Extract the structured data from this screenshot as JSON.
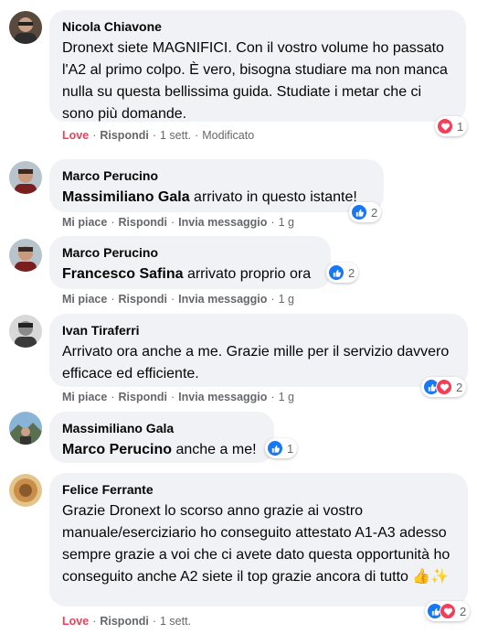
{
  "comments": [
    {
      "author": "Nicola Chiavone",
      "mention": "",
      "text": "Dronext siete MAGNIFICI. Con il vostro volume ho passato l'A2 al primo colpo. È vero, bisogna studiare ma non manca nulla su questa bellissima guida. Studiate i metar che ci sono più domande.",
      "reaction_action": "Love",
      "reply": "Rispondi",
      "time": "1 sett.",
      "edited": "Modificato",
      "reactions_count": "1"
    },
    {
      "author": "Marco Perucino",
      "mention": "Massimiliano Gala",
      "text": " arrivato in questo istante!",
      "reaction_action": "Mi piace",
      "reply": "Rispondi",
      "message": "Invia messaggio",
      "time": "1 g",
      "reactions_count": "2"
    },
    {
      "author": "Marco Perucino",
      "mention": "Francesco Safina",
      "text": " arrivato proprio ora",
      "reaction_action": "Mi piace",
      "reply": "Rispondi",
      "message": "Invia messaggio",
      "time": "1 g",
      "reactions_count": "2"
    },
    {
      "author": "Ivan Tiraferri",
      "mention": "",
      "text": "Arrivato ora anche a me. Grazie mille per il servizio davvero efficace ed efficiente.",
      "reaction_action": "Mi piace",
      "reply": "Rispondi",
      "message": "Invia messaggio",
      "time": "1 g",
      "reactions_count": "2"
    },
    {
      "author": "Massimiliano Gala",
      "mention": "Marco Perucino",
      "text": " anche a me!",
      "reactions_count": "1"
    },
    {
      "author": "Felice Ferrante",
      "mention": "",
      "text": "Grazie Dronext lo scorso anno grazie ai vostro manuale/eserciziario ho conseguito attestato A1-A3 adesso sempre grazie a voi che ci avete dato questa opportunità ho conseguito anche A2 siete il top grazie ancora di tutto 👍✨",
      "reaction_action": "Love",
      "reply": "Rispondi",
      "time": "1 sett.",
      "reactions_count": "2"
    }
  ],
  "colors": {
    "like": "#1877f2",
    "love": "#f33e58",
    "bubble": "#f0f2f5",
    "meta": "#65676b"
  },
  "icons": {
    "like": "thumbs-up-icon",
    "love": "heart-icon"
  }
}
